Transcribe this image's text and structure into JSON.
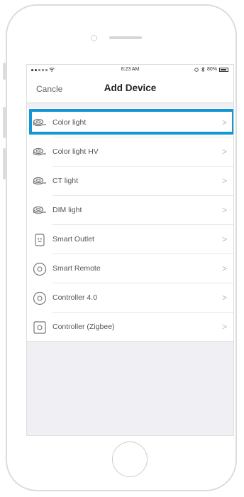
{
  "status_bar": {
    "time": "8:23 AM",
    "battery": "80%"
  },
  "nav": {
    "cancel_label": "Cancle",
    "title": "Add Device"
  },
  "devices": [
    {
      "label": "Color light",
      "icon": "led-strip-icon"
    },
    {
      "label": "Color light HV",
      "icon": "led-strip-icon"
    },
    {
      "label": "CT light",
      "icon": "led-strip-icon"
    },
    {
      "label": "DIM light",
      "icon": "led-strip-icon"
    },
    {
      "label": "Smart Outlet",
      "icon": "outlet-icon"
    },
    {
      "label": "Smart Remote",
      "icon": "remote-icon"
    },
    {
      "label": "Controller 4.0",
      "icon": "controller-icon"
    },
    {
      "label": "Controller (Zigbee)",
      "icon": "zigbee-controller-icon"
    }
  ],
  "chevron": ">",
  "highlight_color": "#1296d4"
}
